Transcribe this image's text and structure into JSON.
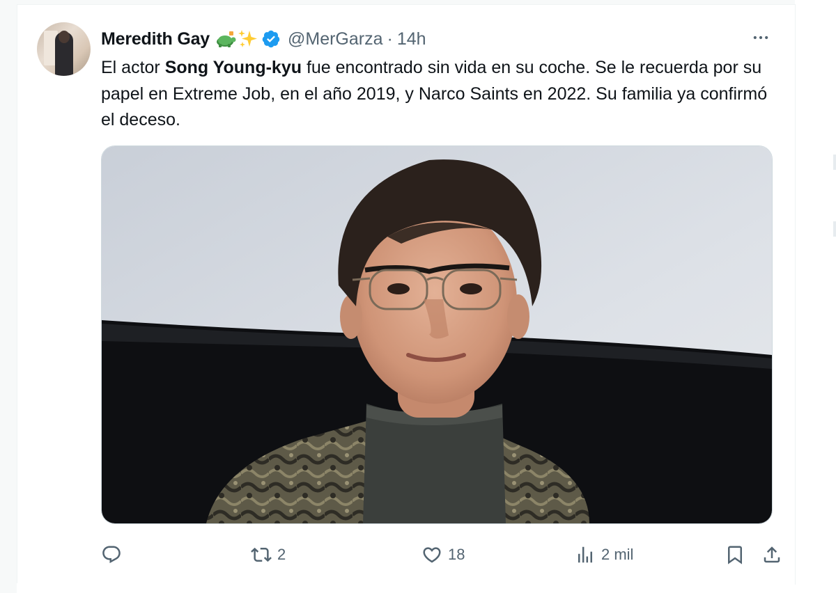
{
  "tweet": {
    "author_name": "Meredith Gay",
    "author_emojis": [
      "turtle-emoji",
      "sparkles-emoji"
    ],
    "verified": true,
    "handle": "@MerGarza",
    "separator": "·",
    "time": "14h",
    "text_part1": "El actor ",
    "text_bold": "Song Young-kyu",
    "text_part2": " fue encontrado sin vida en su coche. Se le recuerda por su papel en Extreme Job, en el año 2019, y Narco Saints en 2022. Su familia ya confirmó el deceso.",
    "image_subject": "photo-of-actor"
  },
  "actions": {
    "reply_count": "",
    "retweet_count": "2",
    "like_count": "18",
    "views_count": "2 mil"
  },
  "colors": {
    "text_primary": "#0f1419",
    "text_secondary": "#536471",
    "verified_blue": "#1d9bf0",
    "border": "#cfd9de"
  },
  "icons": {
    "more": "more-horizontal-icon",
    "reply": "reply-icon",
    "retweet": "retweet-icon",
    "like": "heart-icon",
    "views": "views-chart-icon",
    "bookmark": "bookmark-icon",
    "share": "share-icon"
  }
}
